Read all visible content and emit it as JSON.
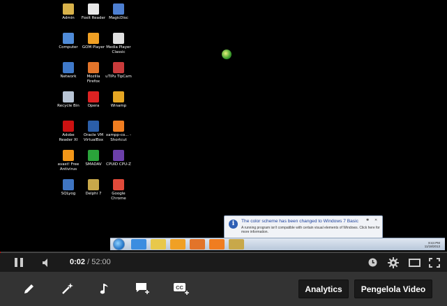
{
  "desktop": {
    "icons": [
      {
        "label": "Admin",
        "color": "#d8b24a"
      },
      {
        "label": "Foxit Reader",
        "color": "#e8e8e8"
      },
      {
        "label": "MagicDisc",
        "color": "#4d7fd1"
      },
      {
        "label": "Computer",
        "color": "#4f8bd8"
      },
      {
        "label": "GOM Player",
        "color": "#f0a024"
      },
      {
        "label": "Media Player Classic",
        "color": "#e0e0e0"
      },
      {
        "label": "Network",
        "color": "#3f79c9"
      },
      {
        "label": "Mozilla Firefox",
        "color": "#e2742a"
      },
      {
        "label": "uTIPu TipCam",
        "color": "#c93b3b"
      },
      {
        "label": "Recycle Bin",
        "color": "#b8c4d4"
      },
      {
        "label": "Opera",
        "color": "#d22"
      },
      {
        "label": "Winamp",
        "color": "#e5a623"
      },
      {
        "label": "Adobe Reader XI",
        "color": "#c11"
      },
      {
        "label": "Oracle VM VirtualBox",
        "color": "#2b5ea8"
      },
      {
        "label": "xampp-co... - Shortcut",
        "color": "#f07d20"
      },
      {
        "label": "avast! Free Antivirus",
        "color": "#f29618"
      },
      {
        "label": "SMADAV",
        "color": "#2aa33a"
      },
      {
        "label": "CPUID CPU-Z",
        "color": "#6b3fa8"
      },
      {
        "label": "SQLyog",
        "color": "#3f75c2"
      },
      {
        "label": "Delphi 7",
        "color": "#c8a84a"
      },
      {
        "label": "Google Chrome",
        "color": "#e04a3a"
      }
    ],
    "notification": {
      "title": "The color scheme has been changed to Windows 7 Basic",
      "body": "A running program isn't compatible with certain visual elements of Windows. Click here for more information.",
      "info_icon": "i"
    },
    "taskbar": {
      "apps": [
        {
          "name": "internet-explorer",
          "color": "#3b8de0"
        },
        {
          "name": "explorer",
          "color": "#e8c84a"
        },
        {
          "name": "media-player",
          "color": "#f0a024"
        },
        {
          "name": "firefox",
          "color": "#e2742a"
        },
        {
          "name": "xampp",
          "color": "#f07d20"
        },
        {
          "name": "delphi",
          "color": "#c8a84a"
        }
      ],
      "clock_time": "8:44 PM",
      "clock_date": "11/18/2013"
    }
  },
  "player": {
    "current_time": "0:02",
    "separator": " / ",
    "duration": "52:00",
    "progress": 0.001
  },
  "toolbar": {
    "analytics_label": "Analytics",
    "manage_label": "Pengelola Video"
  }
}
